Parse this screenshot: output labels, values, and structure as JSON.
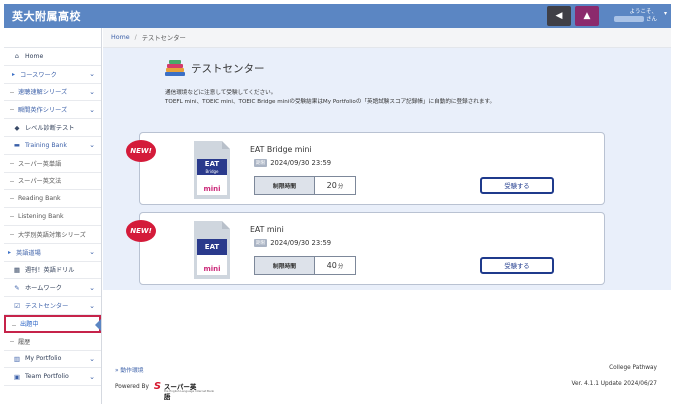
{
  "app": {
    "title": "英大附属高校"
  },
  "header": {
    "notice_icon": "megaphone-icon",
    "bell_icon": "bell-icon",
    "user_greeting": "ようこそ、",
    "user_suffix": "さん"
  },
  "sidebar": {
    "items": [
      {
        "label": "Home",
        "icon": "home-icon"
      },
      {
        "label": "コースワーク"
      },
      {
        "label": "速聴速解シリーズ"
      },
      {
        "label": "瞬間英作シリーズ"
      },
      {
        "label": "レベル診断テスト",
        "icon": "graduation-icon"
      },
      {
        "label": "Training Bank",
        "icon": "book-icon"
      },
      {
        "label": "スーパー英単語"
      },
      {
        "label": "スーパー英文法"
      },
      {
        "label": "Reading Bank"
      },
      {
        "label": "Listening Bank"
      },
      {
        "label": "大学別英語対策シリーズ"
      },
      {
        "label": "英語道場"
      },
      {
        "label": "週刊！英語ドリル",
        "icon": "calendar-icon"
      },
      {
        "label": "ホームワーク",
        "icon": "pencil-icon"
      },
      {
        "label": "テストセンター",
        "icon": "checkbox-icon"
      },
      {
        "label": "出題中"
      },
      {
        "label": "履歴"
      },
      {
        "label": "My Portfolio",
        "icon": "chart-icon"
      },
      {
        "label": "Team Portfolio",
        "icon": "team-icon"
      }
    ]
  },
  "breadcrumb": {
    "home": "Home",
    "sep": "/",
    "current": "テストセンター"
  },
  "page": {
    "title": "テストセンター",
    "desc1": "通信環境などに注意して受験してください。",
    "desc2": "TOEFL mini、TOEIC mini、TOEIC Bridge miniの受験結果はMy Portfolioの「英語試験スコア記録帳」に自動的に登録されます。"
  },
  "tests": [
    {
      "badge": "NEW!",
      "cover_title": "EAT",
      "cover_sub": "Bridge",
      "cover_mini": "mini",
      "name": "EAT Bridge mini",
      "deadline_tag": "期限",
      "deadline": "2024/09/30 23:59",
      "time_label": "制限時間",
      "time_value": "20",
      "time_unit": "分",
      "button": "受験する"
    },
    {
      "badge": "NEW!",
      "cover_title": "EAT",
      "cover_sub": "",
      "cover_mini": "mini",
      "name": "EAT mini",
      "deadline_tag": "期限",
      "deadline": "2024/09/30 23:59",
      "time_label": "制限時間",
      "time_value": "40",
      "time_unit": "分",
      "button": "受験する"
    }
  ],
  "footer": {
    "env": "» 動作環境",
    "powered": "Powered By",
    "logo_s": "S",
    "logo_text": "スーパー英語",
    "logo_tagline": "the English Language Internet Bank",
    "product": "College Pathway",
    "version": "Ver. 4.1.1 Update 2024/06/27"
  },
  "colors": {
    "header": "#5b86c3",
    "panel": "#e9effa",
    "badge": "#d41b3a",
    "active_border": "#c6234a",
    "button": "#1f3a8c"
  }
}
